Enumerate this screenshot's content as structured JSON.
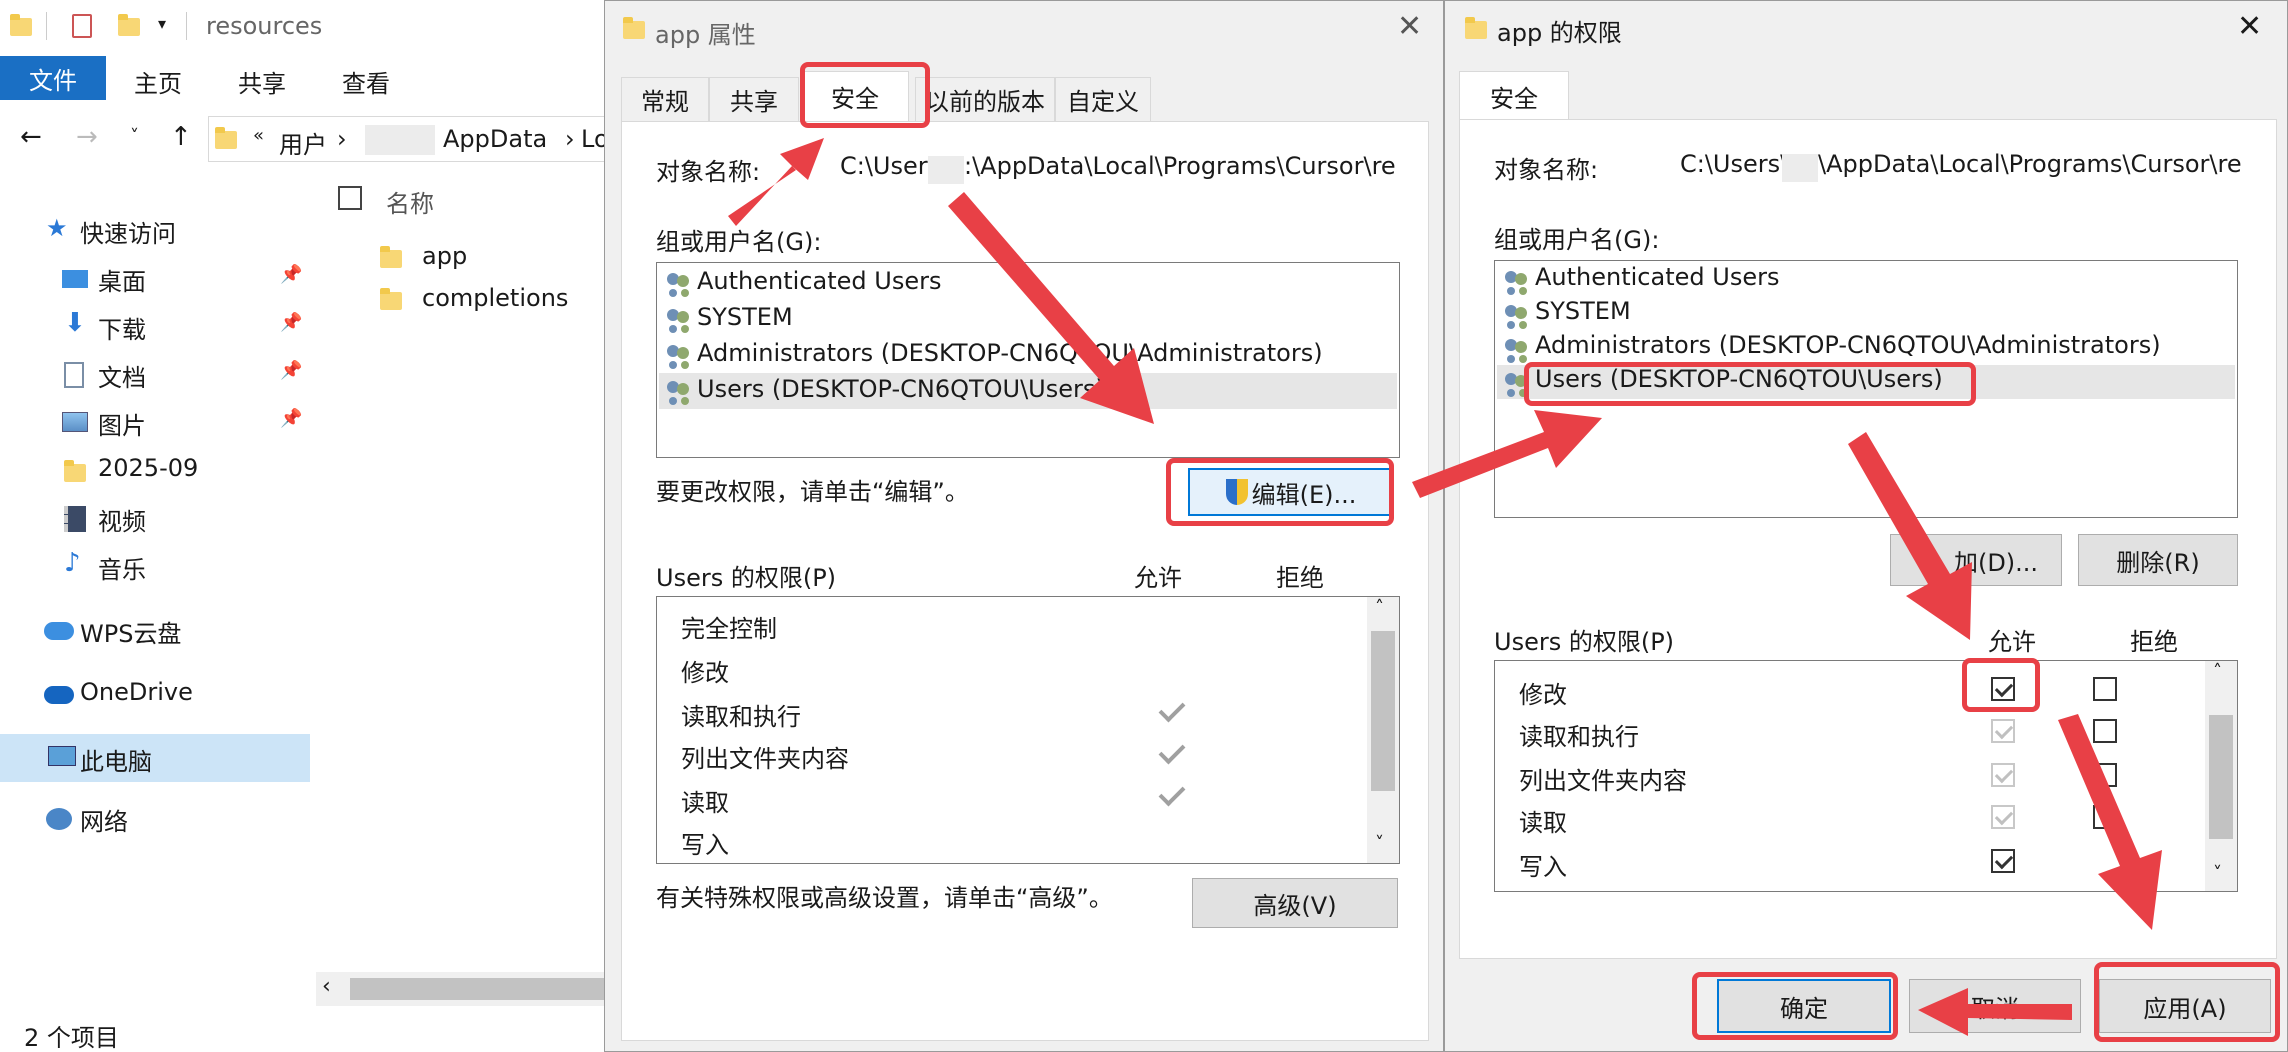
{
  "explorer": {
    "breadcrumb_title": "resources",
    "ribbon_tabs": [
      "文件",
      "主页",
      "共享",
      "查看"
    ],
    "address": [
      "«",
      "用户",
      "›",
      "AppData",
      "›",
      "Lo"
    ],
    "column_name": "名称",
    "files": [
      "app",
      "completions"
    ],
    "nav_items": [
      {
        "label": "快速访问",
        "icon": "star-icon"
      },
      {
        "label": "桌面",
        "icon": "desktop-icon"
      },
      {
        "label": "下载",
        "icon": "download-icon"
      },
      {
        "label": "文档",
        "icon": "document-icon"
      },
      {
        "label": "图片",
        "icon": "picture-icon"
      },
      {
        "label": "2025-09",
        "icon": "folder-icon"
      },
      {
        "label": "视频",
        "icon": "video-icon"
      },
      {
        "label": "音乐",
        "icon": "music-icon"
      },
      {
        "label": "WPS云盘",
        "icon": "cloud-icon"
      },
      {
        "label": "OneDrive",
        "icon": "cloud-icon"
      },
      {
        "label": "此电脑",
        "icon": "computer-icon"
      },
      {
        "label": "网络",
        "icon": "network-icon"
      }
    ],
    "status": "2 个项目"
  },
  "props": {
    "title": "app 属性",
    "tabs": [
      "常规",
      "共享",
      "安全",
      "以前的版本",
      "自定义"
    ],
    "object_label": "对象名称:",
    "object_path_a": "C:\\Users\\",
    "object_path_b": ":\\AppData\\Local\\Programs\\Cursor\\re",
    "group_label": "组或用户名(G):",
    "users": [
      "Authenticated Users",
      "SYSTEM",
      "Administrators (DESKTOP-CN6QTOU\\Administrators)",
      "Users (DESKTOP-CN6QTOU\\Users)"
    ],
    "edit_hint": "要更改权限，请单击“编辑”。",
    "edit_button": "编辑(E)...",
    "perm_label": "Users 的权限(P)",
    "allow": "允许",
    "deny": "拒绝",
    "perms": [
      "完全控制",
      "修改",
      "读取和执行",
      "列出文件夹内容",
      "读取",
      "写入"
    ],
    "adv_hint": "有关特殊权限或高级设置，请单击“高级”。",
    "adv_button": "高级(V)"
  },
  "perm_dlg": {
    "title": "app 的权限",
    "tab": "安全",
    "object_label": "对象名称:",
    "object_path_a": "C:\\Users\\",
    "object_path_b": "\\AppData\\Local\\Programs\\Cursor\\re",
    "group_label": "组或用户名(G):",
    "users": [
      "Authenticated Users",
      "SYSTEM",
      "Administrators (DESKTOP-CN6QTOU\\Administrators)",
      "Users (DESKTOP-CN6QTOU\\Users)"
    ],
    "add_button": "加(D)...",
    "remove_button": "删除(R)",
    "perm_label": "Users 的权限(P)",
    "allow": "允许",
    "deny": "拒绝",
    "perms": [
      "修改",
      "读取和执行",
      "列出文件夹内容",
      "读取",
      "写入"
    ],
    "ok_button": "确定",
    "cancel_button": "取消",
    "apply_button": "应用(A)"
  },
  "colors": {
    "accent": "#0078d7",
    "highlight": "#e84046"
  }
}
